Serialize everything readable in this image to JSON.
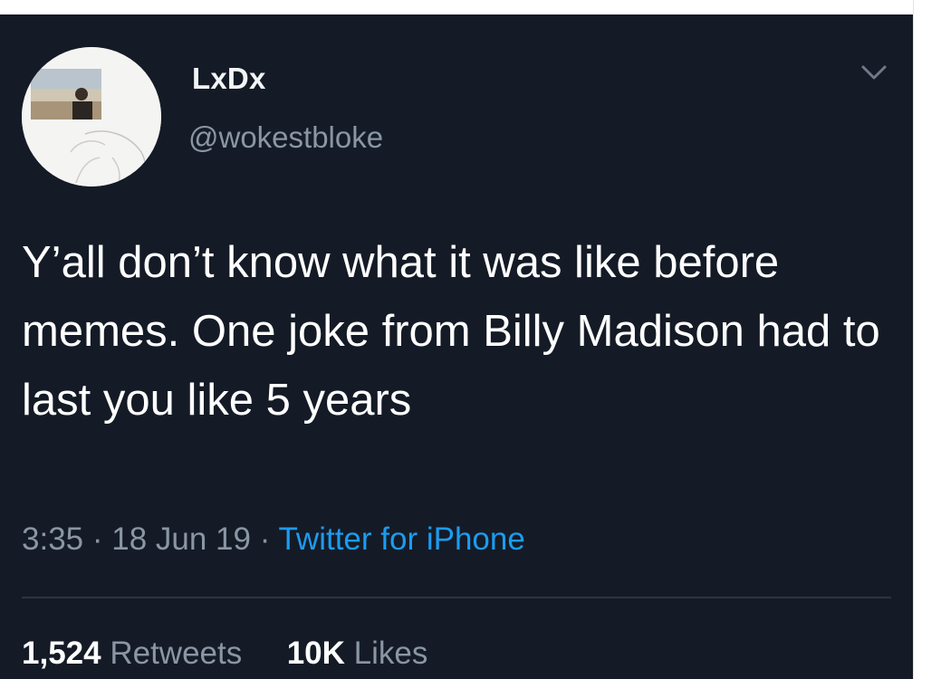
{
  "tweet": {
    "display_name": "LxDx",
    "handle": "@wokestbloke",
    "text": "Y’all don’t know what it was like before memes. One joke from Billy Madison had to last you like 5 years",
    "time": "3:35",
    "date": "18 Jun 19",
    "separator": "·",
    "source": "Twitter for iPhone",
    "menu_icon": "chevron-down-icon",
    "avatar_icon": "avatar-photo"
  },
  "stats": {
    "retweets_count": "1,524",
    "retweets_label": "Retweets",
    "likes_count": "10K",
    "likes_label": "Likes"
  },
  "colors": {
    "background": "#141b26",
    "primary_text": "#ffffff",
    "secondary_text": "#8a96a3",
    "accent": "#1d9bf0"
  }
}
